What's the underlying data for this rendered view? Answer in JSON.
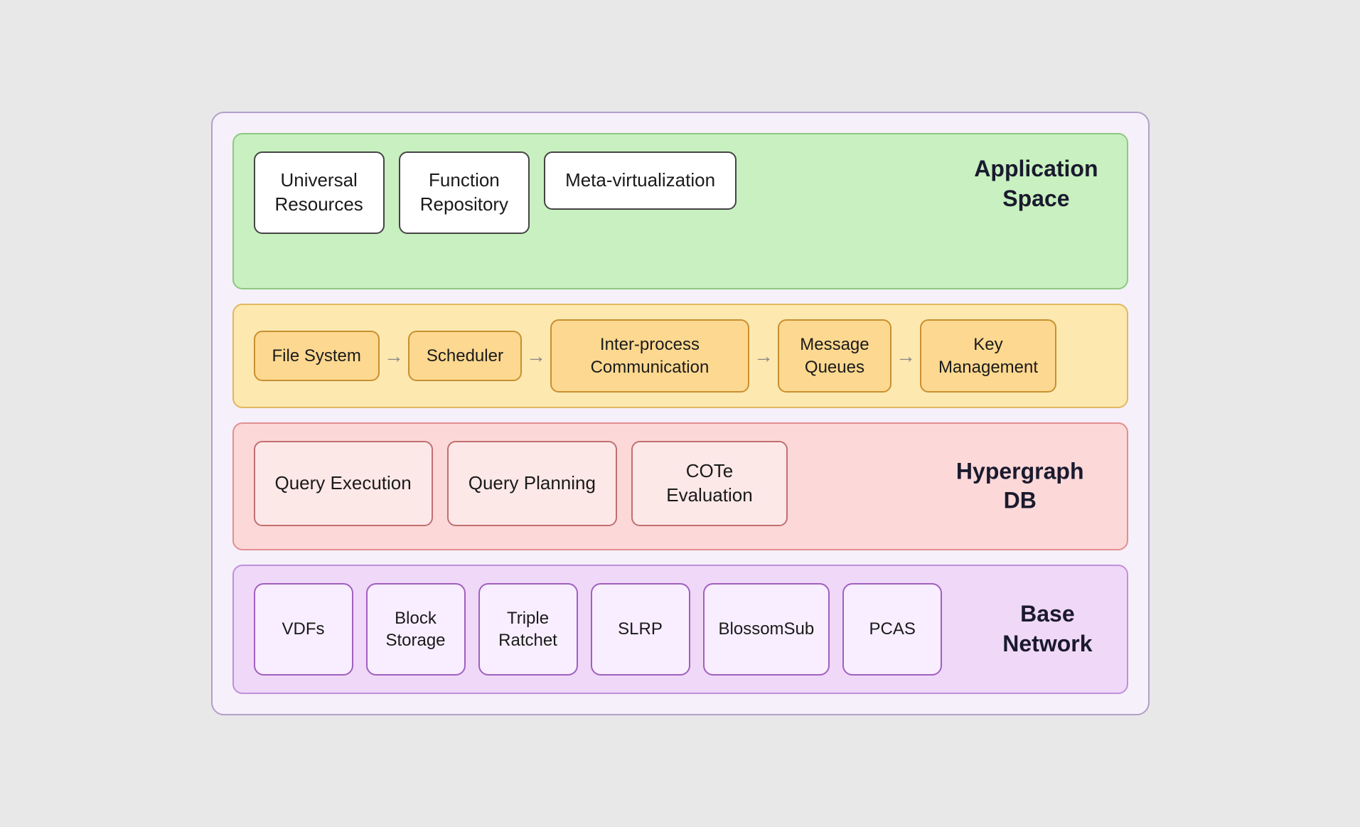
{
  "appSpace": {
    "label": "Application\nSpace",
    "boxes": [
      {
        "id": "universal-resources",
        "text": "Universal\nResources"
      },
      {
        "id": "function-repository",
        "text": "Function\nRepository"
      },
      {
        "id": "meta-virtualization",
        "text": "Meta-virtualization"
      }
    ]
  },
  "osLayer": {
    "boxes": [
      {
        "id": "file-system",
        "text": "File System"
      },
      {
        "id": "scheduler",
        "text": "Scheduler"
      },
      {
        "id": "ipc",
        "text": "Inter-process\nCommunication"
      },
      {
        "id": "message-queues",
        "text": "Message\nQueues"
      },
      {
        "id": "key-management",
        "text": "Key\nManagement"
      }
    ]
  },
  "hypergraphDB": {
    "label": "Hypergraph\nDB",
    "boxes": [
      {
        "id": "query-execution",
        "text": "Query Execution"
      },
      {
        "id": "query-planning",
        "text": "Query Planning"
      },
      {
        "id": "cote-evaluation",
        "text": "COTe\nEvaluation"
      }
    ]
  },
  "baseNetwork": {
    "label": "Base\nNetwork",
    "boxes": [
      {
        "id": "vdfs",
        "text": "VDFs"
      },
      {
        "id": "block-storage",
        "text": "Block\nStorage"
      },
      {
        "id": "triple-ratchet",
        "text": "Triple\nRatchet"
      },
      {
        "id": "slrp",
        "text": "SLRP"
      },
      {
        "id": "blossomsub",
        "text": "BlossomSub"
      },
      {
        "id": "pcas",
        "text": "PCAS"
      }
    ]
  }
}
